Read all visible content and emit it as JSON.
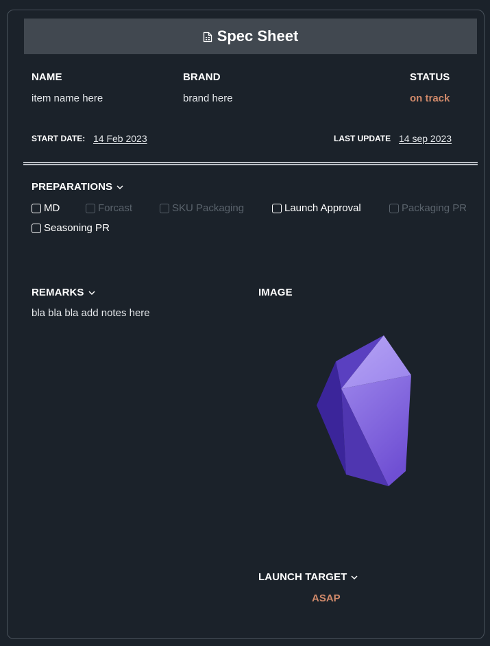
{
  "header": {
    "title": "Spec Sheet",
    "icon": "document-icon"
  },
  "fields": {
    "name": {
      "label": "NAME",
      "value": "item name here"
    },
    "brand": {
      "label": "BRAND",
      "value": "brand here"
    },
    "status": {
      "label": "STATUS",
      "value": "on track"
    },
    "start_date": {
      "label": "START DATE:",
      "value": "14 Feb 2023"
    },
    "last_update": {
      "label": "LAST UPDATE",
      "value": "14 sep 2023"
    }
  },
  "preparations": {
    "label": "PREPARATIONS",
    "items": [
      {
        "label": "MD",
        "enabled": true
      },
      {
        "label": "Forcast",
        "enabled": false
      },
      {
        "label": "SKU Packaging",
        "enabled": false
      },
      {
        "label": "Launch Approval",
        "enabled": true
      },
      {
        "label": "Packaging PR",
        "enabled": false
      },
      {
        "label": "Seasoning PR",
        "enabled": true
      }
    ]
  },
  "remarks": {
    "label": "REMARKS",
    "value": "bla bla bla add notes here"
  },
  "image": {
    "label": "IMAGE",
    "icon": "crystal-gem-image"
  },
  "launch_target": {
    "label": "LAUNCH TARGET",
    "value": "ASAP"
  },
  "colors": {
    "background": "#1b222a",
    "header": "#414850",
    "accent": "#d0896a",
    "gem": "#7b5fd9"
  }
}
